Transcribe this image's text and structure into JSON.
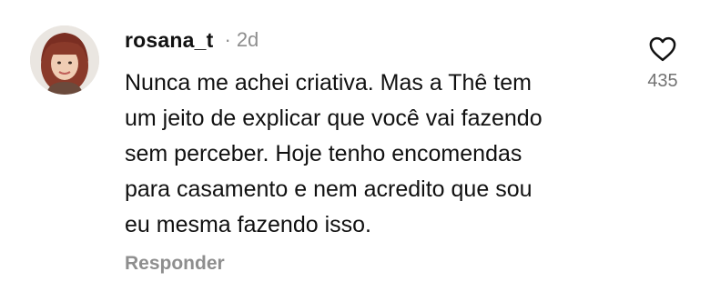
{
  "comment": {
    "username": "rosana_t",
    "separator": "·",
    "timestamp": "2d",
    "lines": [
      "Nunca me achei criativa. Mas a Thê tem",
      "um jeito de explicar que você vai fazendo",
      "sem perceber. Hoje tenho encomendas",
      "para casamento e nem acredito que sou",
      "eu mesma fazendo isso."
    ],
    "reply_label": "Responder",
    "like_count": "435",
    "like_icon": "heart-outline-icon"
  },
  "colors": {
    "text": "#111111",
    "muted": "#8e8e8e",
    "hair": "#8a3a2a"
  }
}
